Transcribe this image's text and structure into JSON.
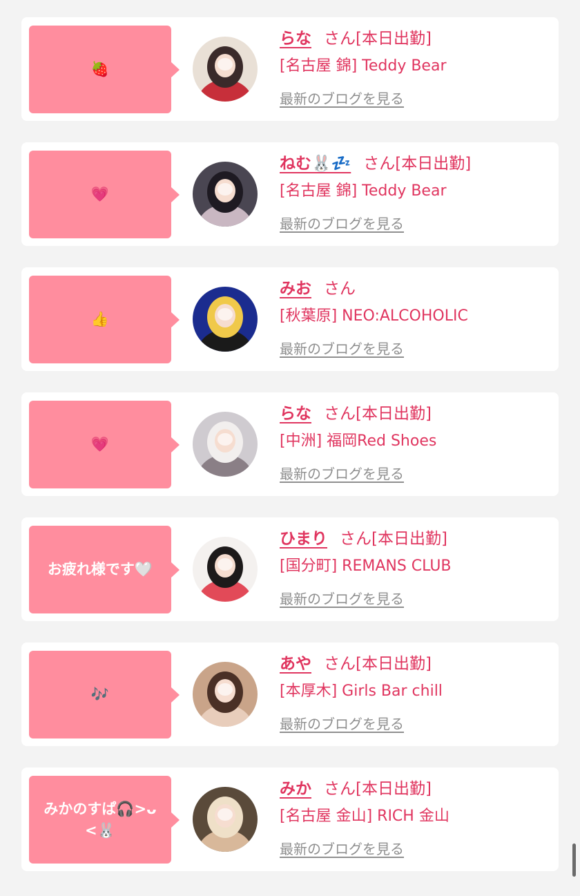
{
  "colors": {
    "accent": "#e0355f",
    "bubble": "#ff8d9e",
    "link": "#8f8f8f",
    "background": "#f3f3f3",
    "card": "#ffffff"
  },
  "entries": [
    {
      "message": "🍓",
      "name": "らな",
      "suffix": "さん[本日出勤]",
      "shop": "[名古屋 錦] Teddy Bear",
      "blog_link": "最新のブログを見る",
      "avatar_colors": [
        "#e9e0d6",
        "#3a2a2a",
        "#c72f3a"
      ]
    },
    {
      "message": "💗",
      "name": "ねむ🐰💤",
      "suffix": "さん[本日出勤]",
      "shop": "[名古屋 錦] Teddy Bear",
      "blog_link": "最新のブログを見る",
      "avatar_colors": [
        "#4a4652",
        "#1e1a22",
        "#c9b7c2"
      ]
    },
    {
      "message": "👍",
      "name": "みお",
      "suffix": "さん",
      "shop": "[秋葉原] NEO:ALCOHOLIC",
      "blog_link": "最新のブログを見る",
      "avatar_colors": [
        "#1b2c8f",
        "#f0c94a",
        "#1a1a1a"
      ]
    },
    {
      "message": "💗",
      "name": "らな",
      "suffix": "さん[本日出勤]",
      "shop": "[中洲] 福岡Red Shoes",
      "blog_link": "最新のブログを見る",
      "avatar_colors": [
        "#cfcbd0",
        "#f2efee",
        "#8a7f86"
      ]
    },
    {
      "message": "お疲れ様です🤍",
      "name": "ひまり",
      "suffix": "さん[本日出勤]",
      "shop": "[国分町] REMANS CLUB",
      "blog_link": "最新のブログを見る",
      "avatar_colors": [
        "#f4f1ef",
        "#1d1a1a",
        "#e24a58"
      ]
    },
    {
      "message": "🎶",
      "name": "あや",
      "suffix": "さん[本日出勤]",
      "shop": "[本厚木] Girls Bar chill",
      "blog_link": "最新のブログを見る",
      "avatar_colors": [
        "#c9a489",
        "#4a3026",
        "#e8cdbb"
      ]
    },
    {
      "message": "みかのすぱ🎧>ᴗ<🐰",
      "name": "みか",
      "suffix": "さん[本日出勤]",
      "shop": "[名古屋 金山] RICH 金山",
      "blog_link": "最新のブログを見る",
      "avatar_colors": [
        "#5a4a3a",
        "#efe0c8",
        "#d8b89a"
      ]
    }
  ]
}
